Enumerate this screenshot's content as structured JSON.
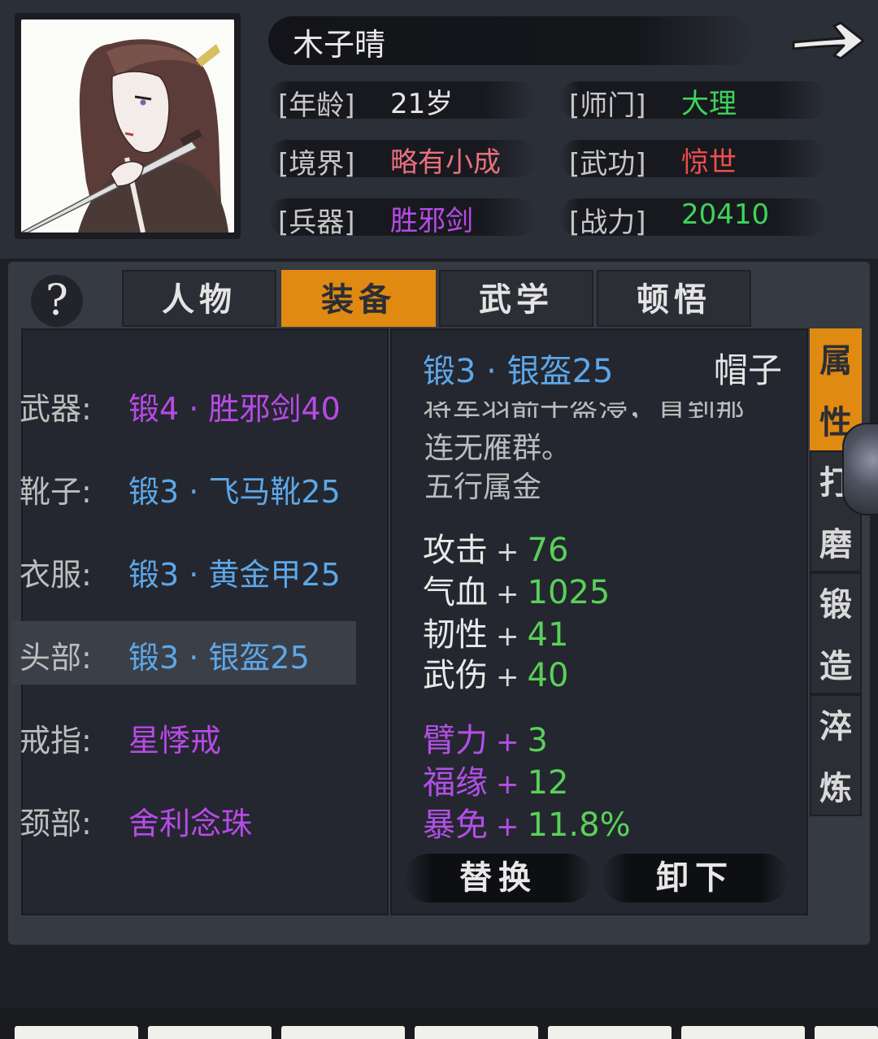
{
  "character": {
    "name": "木子晴",
    "fields": [
      {
        "label": "[年龄]",
        "value": "21岁",
        "color": "#e6e6e6"
      },
      {
        "label": "[师门]",
        "value": "大理",
        "color": "#3ed45a"
      },
      {
        "label": "[境界]",
        "value": "略有小成",
        "color": "#e8707e"
      },
      {
        "label": "[武功]",
        "value": "惊世",
        "color": "#ef4e4e"
      },
      {
        "label": "[兵器]",
        "value": "胜邪剑",
        "color": "#b84ae8"
      },
      {
        "label": "[战力]",
        "value": "20410",
        "color": "#3ed45a"
      }
    ]
  },
  "help": {
    "label": "?"
  },
  "tabs": [
    {
      "label": "人物",
      "active": false
    },
    {
      "label": "装备",
      "active": true
    },
    {
      "label": "武学",
      "active": false
    },
    {
      "label": "顿悟",
      "active": false
    }
  ],
  "equipment": [
    {
      "slot": "武器:",
      "item": "锻4 · 胜邪剑40",
      "color": "#b84ae8",
      "selected": false
    },
    {
      "slot": "靴子:",
      "item": "锻3 · 飞马靴25",
      "color": "#5da7e8",
      "selected": false
    },
    {
      "slot": "衣服:",
      "item": "锻3 · 黄金甲25",
      "color": "#5da7e8",
      "selected": false
    },
    {
      "slot": "头部:",
      "item": "锻3 · 银盔25",
      "color": "#5da7e8",
      "selected": true
    },
    {
      "slot": "戒指:",
      "item": "星悸戒",
      "color": "#b84ae8",
      "selected": false
    },
    {
      "slot": "颈部:",
      "item": "舍利念珠",
      "color": "#b84ae8",
      "selected": false
    }
  ],
  "detail": {
    "title": "锻3 · 银盔25",
    "type": "帽子",
    "desc_partial": "将军羽箭千盔浸，直到那",
    "desc_lines": [
      "连无雁群。",
      "五行属金"
    ],
    "stats": [
      {
        "name": "攻击",
        "value": "76",
        "tier": "base"
      },
      {
        "name": "气血",
        "value": "1025",
        "tier": "base"
      },
      {
        "name": "韧性",
        "value": "41",
        "tier": "base"
      },
      {
        "name": "武伤",
        "value": "40",
        "tier": "base"
      }
    ],
    "bonus_stats": [
      {
        "name": "臂力",
        "value": "3",
        "tier": "bonus"
      },
      {
        "name": "福缘",
        "value": "12",
        "tier": "bonus"
      },
      {
        "name": "暴免",
        "value": "11.8%",
        "tier": "bonus"
      }
    ],
    "plus_sign": "+",
    "replace_label": "替换",
    "unequip_label": "卸下"
  },
  "side_tabs": [
    {
      "label": "属性",
      "active": true
    },
    {
      "label": "打磨",
      "active": false
    },
    {
      "label": "锻造",
      "active": false
    },
    {
      "label": "淬炼",
      "active": false
    }
  ],
  "icons": {
    "next": "right-arrow-icon",
    "help": "question-icon"
  }
}
